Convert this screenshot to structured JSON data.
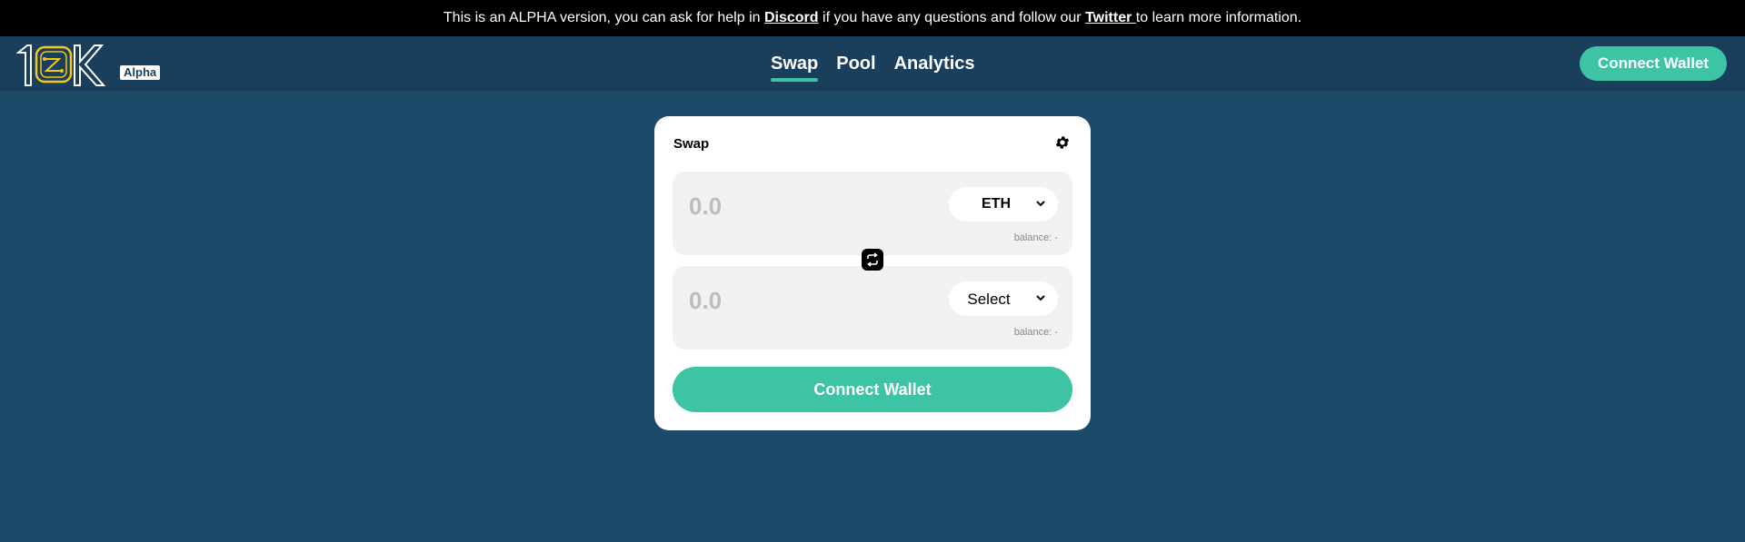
{
  "banner": {
    "text_before_discord": "This is an ALPHA version, you can ask for help in ",
    "discord_link": "Discord",
    "text_middle": " if you have any questions and follow our ",
    "twitter_link": "Twitter ",
    "text_after": "to learn more information."
  },
  "header": {
    "logo_badge": "Alpha",
    "nav": [
      {
        "label": "Swap",
        "active": true
      },
      {
        "label": "Pool",
        "active": false
      },
      {
        "label": "Analytics",
        "active": false
      }
    ],
    "connect_label": "Connect Wallet"
  },
  "swap_card": {
    "title": "Swap",
    "settings_icon": "gear-icon",
    "from": {
      "placeholder": "0.0",
      "token": "ETH",
      "balance": "balance: -"
    },
    "to": {
      "placeholder": "0.0",
      "token": "Select",
      "balance": "balance: -"
    },
    "swap_icon": "swap-arrows-icon",
    "connect_label": "Connect Wallet"
  },
  "colors": {
    "background": "#1e4a6a",
    "header": "#1a3f5c",
    "accent": "#3dc4a5",
    "logo_yellow": "#f5c518"
  }
}
